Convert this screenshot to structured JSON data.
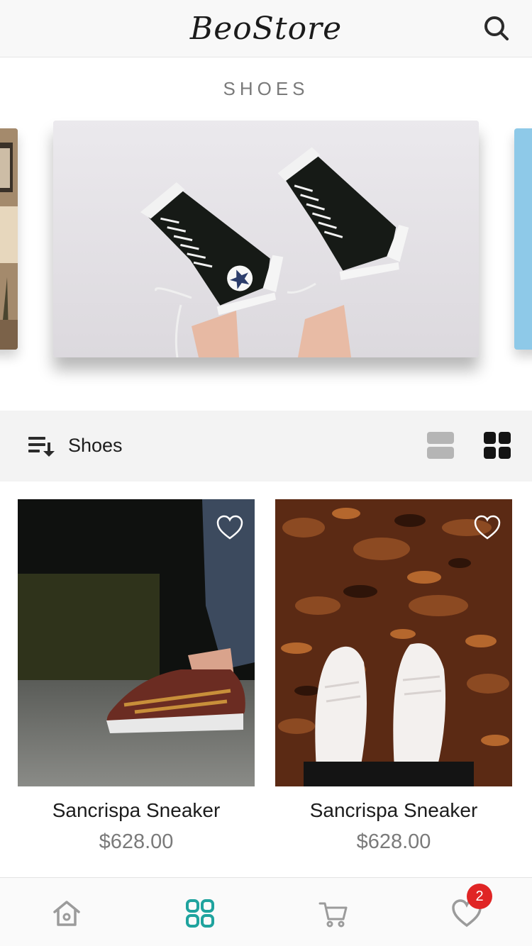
{
  "header": {
    "brand": "BeoStore",
    "search_icon": "search-icon"
  },
  "section": {
    "title": "SHOES"
  },
  "banner": {
    "slides": [
      "previous-slide",
      "shoes-banner",
      "next-slide"
    ]
  },
  "filter_bar": {
    "sort_icon": "sort-icon",
    "category_label": "Shoes",
    "view_list_icon": "list-view-icon",
    "view_grid_icon": "grid-view-icon",
    "active_view": "grid"
  },
  "products": [
    {
      "name": "Sancrispa Sneaker",
      "price": "$628.00",
      "favorite_icon": "heart-outline-icon"
    },
    {
      "name": "Sancrispa Sneaker",
      "price": "$628.00",
      "favorite_icon": "heart-outline-icon"
    }
  ],
  "bottom_nav": {
    "items": [
      {
        "icon": "home-icon",
        "active": false
      },
      {
        "icon": "categories-icon",
        "active": true
      },
      {
        "icon": "cart-icon",
        "active": false
      },
      {
        "icon": "heart-icon",
        "active": false
      }
    ],
    "wishlist_badge": "2"
  },
  "colors": {
    "accent": "#1fa39e",
    "badge": "#e02525",
    "inactive_icon": "#9b9b9b"
  }
}
